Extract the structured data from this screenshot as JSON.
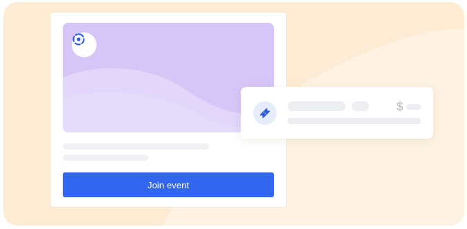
{
  "event_card": {
    "join_button_label": "Join event"
  },
  "ticket_card": {
    "currency_symbol": "$"
  },
  "icons": {
    "logo": "aperture-logo-icon",
    "ticket": "ticket-icon"
  },
  "colors": {
    "background_peach": "#fdecd3",
    "banner_lavender": "#d6c6f7",
    "primary_blue": "#3366ee",
    "skeleton_gray": "#f1f1f3"
  }
}
